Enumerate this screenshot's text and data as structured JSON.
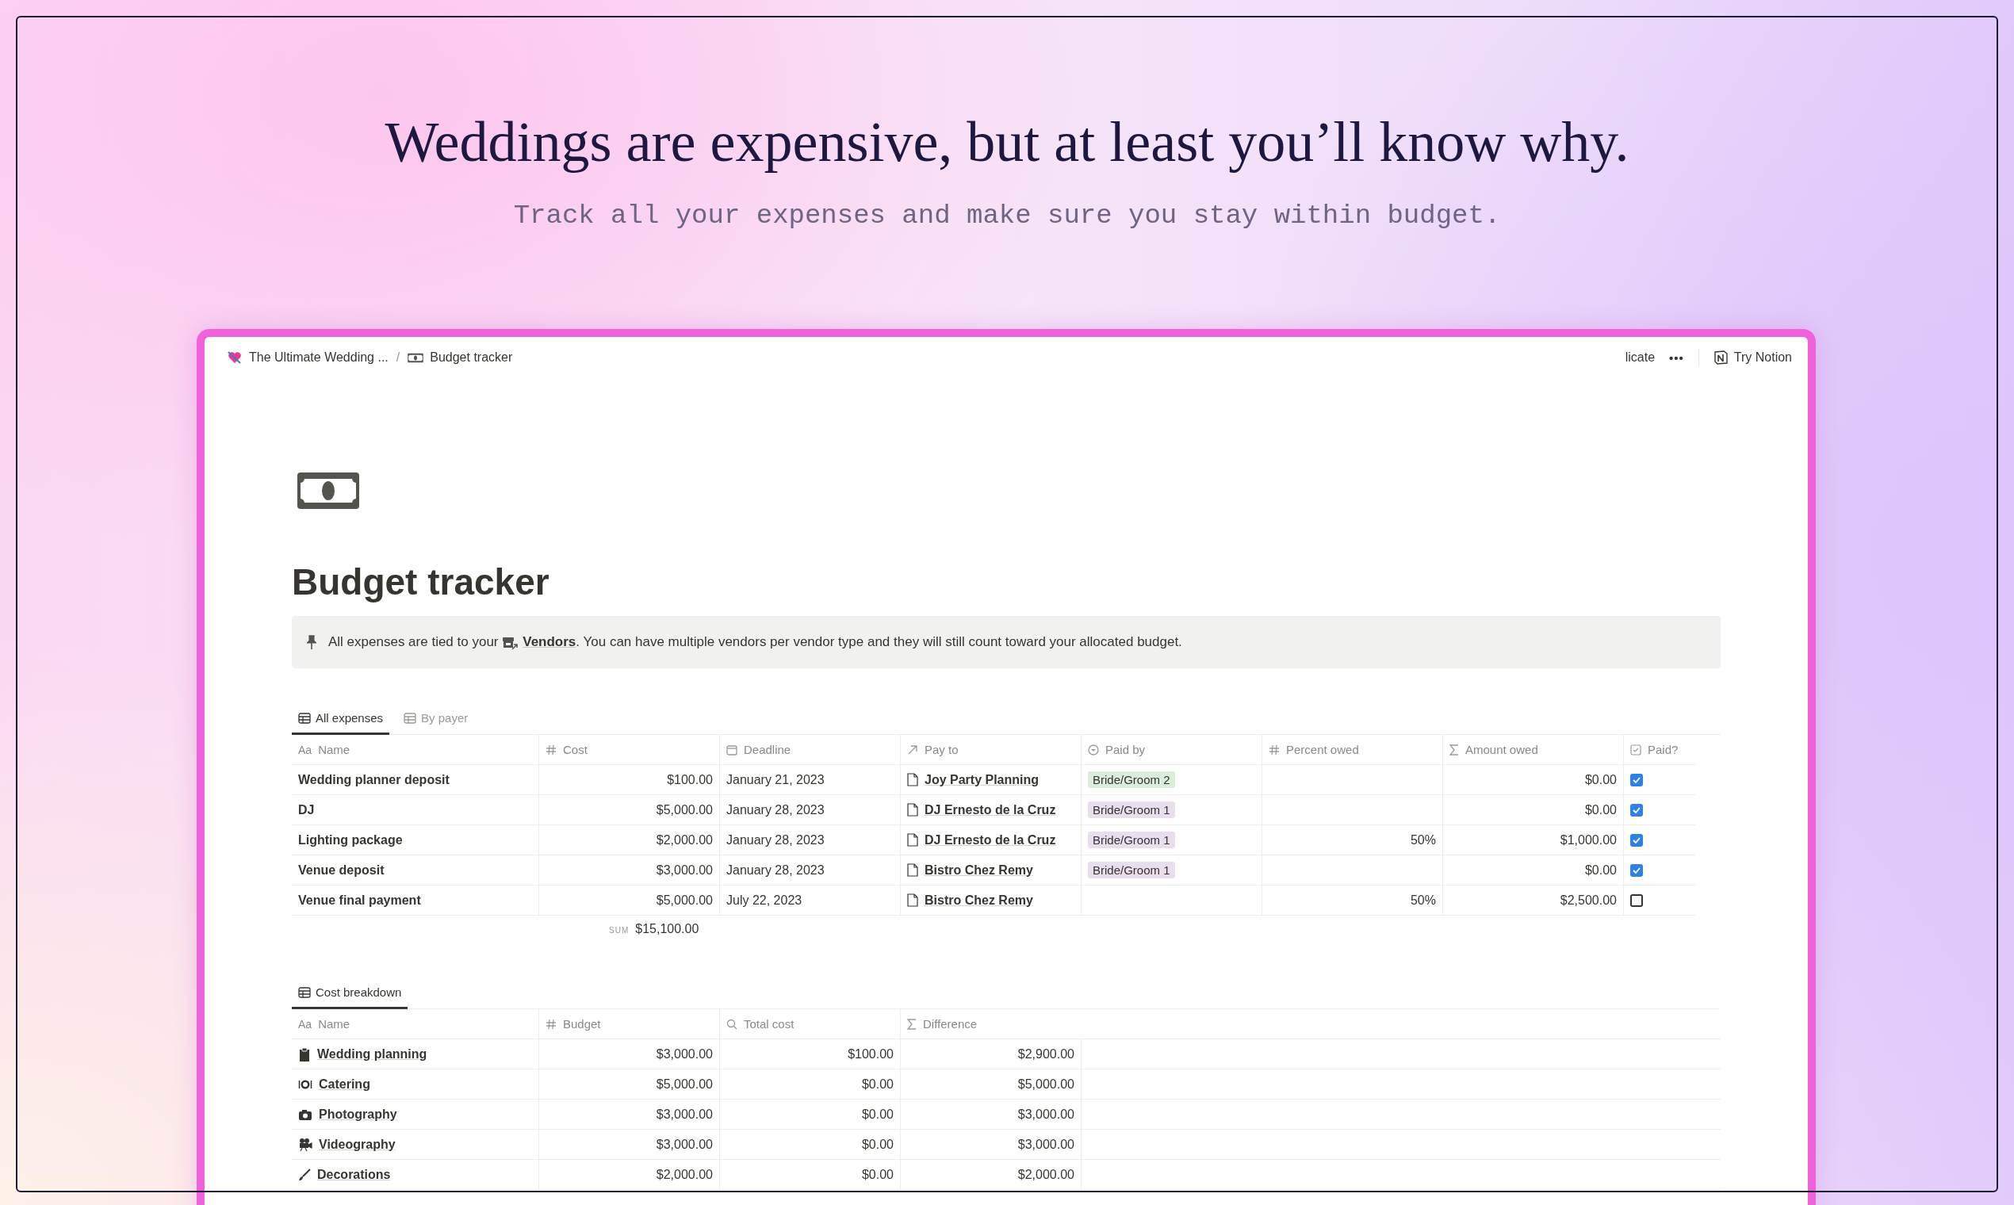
{
  "hero": {
    "headline": "Weddings are expensive, but at least you’ll know why.",
    "subheading": "Track all your expenses and make sure you stay within budget."
  },
  "topbar": {
    "breadcrumb": [
      {
        "text": "The Ultimate Wedding ..."
      },
      {
        "text": "Budget tracker"
      }
    ],
    "separator": "/",
    "cut_action": "licate",
    "more": "•••",
    "try_label": "Try Notion"
  },
  "page": {
    "title": "Budget tracker",
    "callout": {
      "before": "All expenses are tied to your ",
      "link": "Vendors",
      "after": ". You can have multiple vendors per vendor type and they will still count toward your allocated budget."
    }
  },
  "expenses": {
    "views": [
      {
        "label": "All expenses",
        "selected": true
      },
      {
        "label": "By payer",
        "selected": false
      }
    ],
    "columns": [
      {
        "label": "Name",
        "kind": "title",
        "glyph": "Aa"
      },
      {
        "label": "Cost",
        "kind": "number"
      },
      {
        "label": "Deadline",
        "kind": "date"
      },
      {
        "label": "Pay to",
        "kind": "relation"
      },
      {
        "label": "Paid by",
        "kind": "select"
      },
      {
        "label": "Percent owed",
        "kind": "number"
      },
      {
        "label": "Amount owed",
        "kind": "formula"
      },
      {
        "label": "Paid?",
        "kind": "checkbox"
      }
    ],
    "rows": [
      {
        "name": "Wedding planner deposit",
        "cost": "$100.00",
        "deadline": "January 21, 2023",
        "pay_to": {
          "text": "Joy Party Planning"
        },
        "paid_by": {
          "text": "Bride/Groom 2",
          "color": "#dbeddb"
        },
        "amount": "$0.00",
        "paid": true
      },
      {
        "name": "DJ",
        "cost": "$5,000.00",
        "deadline": "January 28, 2023",
        "pay_to": {
          "text": "DJ Ernesto de la Cruz"
        },
        "paid_by": {
          "text": "Bride/Groom 1",
          "color": "#e8deee"
        },
        "amount": "$0.00",
        "paid": true
      },
      {
        "name": "Lighting package",
        "cost": "$2,000.00",
        "deadline": "January 28, 2023",
        "pay_to": {
          "text": "DJ Ernesto de la Cruz"
        },
        "paid_by": {
          "text": "Bride/Groom 1",
          "color": "#e8deee"
        },
        "percent": "50%",
        "amount": "$1,000.00",
        "paid": true
      },
      {
        "name": "Venue deposit",
        "cost": "$3,000.00",
        "deadline": "January 28, 2023",
        "pay_to": {
          "text": "Bistro Chez Remy"
        },
        "paid_by": {
          "text": "Bride/Groom 1",
          "color": "#e8deee"
        },
        "amount": "$0.00",
        "paid": true
      },
      {
        "name": "Venue final payment",
        "cost": "$5,000.00",
        "deadline": "July 22, 2023",
        "pay_to": {
          "text": "Bistro Chez Remy"
        },
        "percent": "50%",
        "amount": "$2,500.00",
        "paid": false
      }
    ],
    "sum": {
      "label": "SUM",
      "value": "$15,100.00"
    }
  },
  "breakdown": {
    "views": [
      {
        "label": "Cost breakdown",
        "selected": true
      }
    ],
    "columns": [
      {
        "label": "Name",
        "kind": "title",
        "glyph": "Aa"
      },
      {
        "label": "Budget",
        "kind": "number"
      },
      {
        "label": "Total cost",
        "kind": "rollup"
      },
      {
        "label": "Difference",
        "kind": "formula"
      }
    ],
    "rows": [
      {
        "name": "Wedding planning",
        "budget": "$3,000.00",
        "total": "$100.00",
        "difference": "$2,900.00"
      },
      {
        "name": "Catering",
        "budget": "$5,000.00",
        "total": "$0.00",
        "difference": "$5,000.00"
      },
      {
        "name": "Photography",
        "budget": "$3,000.00",
        "total": "$0.00",
        "difference": "$3,000.00"
      },
      {
        "name": "Videography",
        "budget": "$3,000.00",
        "total": "$0.00",
        "difference": "$3,000.00"
      },
      {
        "name": "Decorations",
        "budget": "$2,000.00",
        "total": "$0.00",
        "difference": "$2,000.00"
      }
    ]
  }
}
